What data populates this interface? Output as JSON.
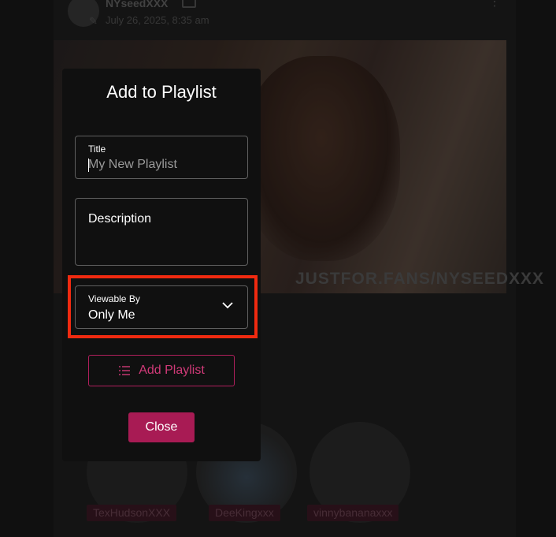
{
  "background": {
    "post": {
      "author": "NYseedXXX",
      "date": "July 26, 2025, 8:35 am",
      "watermark": "JUSTFOR.FANS/NYSEEDXXX"
    },
    "creators": [
      "TexHudsonXXX",
      "DeeKingxxx",
      "vinnybananaxxx"
    ]
  },
  "modal": {
    "title": "Add to Playlist",
    "title_field": {
      "label": "Title",
      "placeholder": "My New Playlist",
      "value": ""
    },
    "description_field": {
      "placeholder": "Description",
      "value": ""
    },
    "viewable_by": {
      "label": "Viewable By",
      "selected": "Only Me"
    },
    "add_button": "Add Playlist",
    "close_button": "Close"
  },
  "colors": {
    "accent": "#a81b54",
    "accent_outline": "#b01f5c",
    "highlight": "#f02a10"
  },
  "icons": {
    "chevron": "chevron-down-icon",
    "list": "list-icon"
  }
}
